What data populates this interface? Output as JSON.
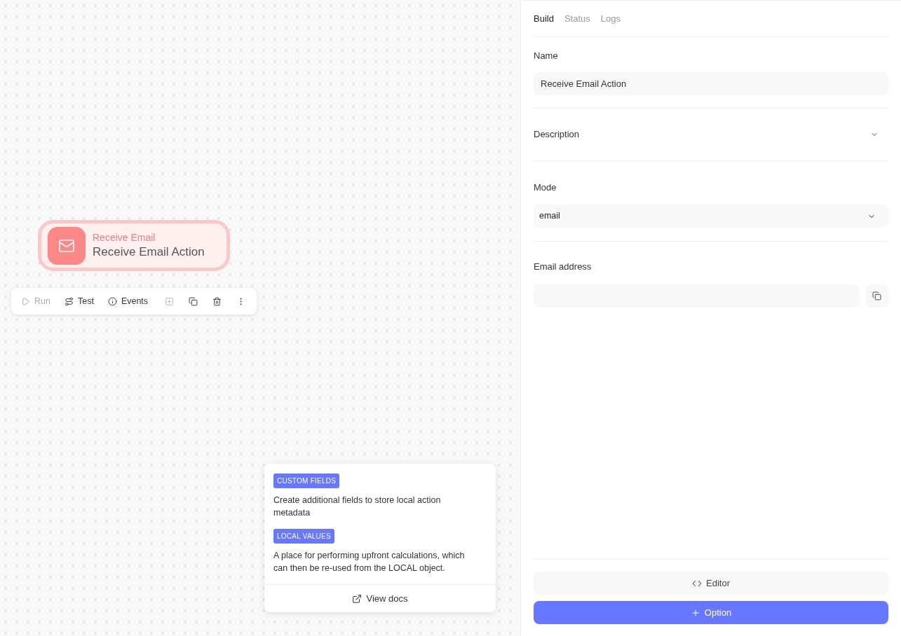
{
  "node": {
    "subtitle": "Receive Email",
    "title": "Receive Email Action",
    "selected": true
  },
  "toolbar": {
    "actions": [
      {
        "label": "Run",
        "disabled": true
      },
      {
        "label": "Test",
        "disabled": false
      },
      {
        "label": "Events",
        "disabled": false
      }
    ],
    "icon_buttons": [
      {
        "disabled": true
      },
      {
        "disabled": false
      },
      {
        "disabled": false
      },
      {
        "disabled": false
      }
    ]
  },
  "help_popover": {
    "sections": [
      {
        "tag": "CUSTOM FIELDS",
        "text": "Create additional fields to store local action metadata"
      },
      {
        "tag": "LOCAL VALUES",
        "text": "A place for performing upfront calculations, which can then be re-used from the LOCAL object."
      }
    ],
    "link": "View docs"
  },
  "panel": {
    "tabs": [
      {
        "label": "Build",
        "selected": true
      },
      {
        "label": "Status",
        "selected": false
      },
      {
        "label": "Logs",
        "selected": false
      }
    ],
    "name": {
      "label": "Name",
      "value": "Receive Email Action"
    },
    "description": {
      "label": "Description",
      "expanded": false
    },
    "mode": {
      "label": "Mode",
      "value": "email"
    },
    "email": {
      "label": "Email address"
    },
    "buttons": {
      "editor": "Editor",
      "option": "Option"
    }
  }
}
